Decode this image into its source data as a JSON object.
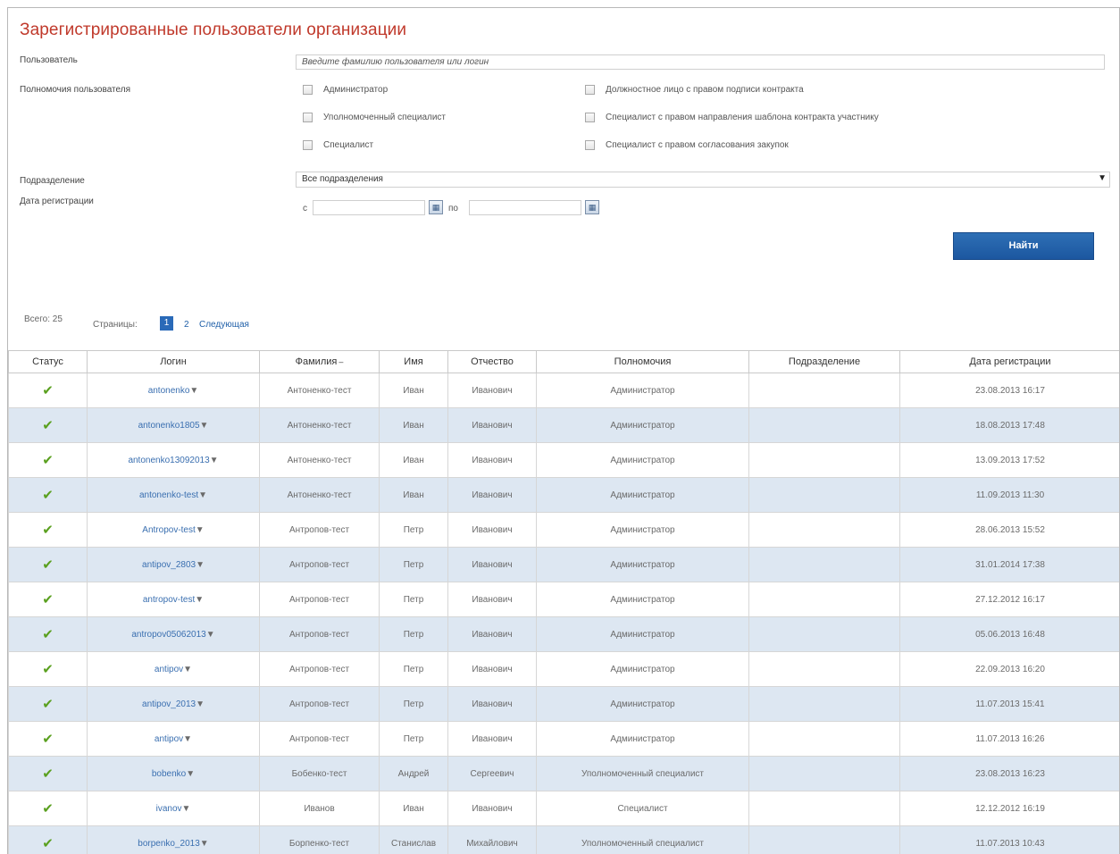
{
  "page": {
    "title": "Зарегистрированные пользователи организации"
  },
  "filters": {
    "user_label": "Пользователь",
    "user_placeholder": "Введите фамилию пользователя или логин",
    "permissions_label": "Полномочия пользователя",
    "permissions": [
      {
        "label": "Администратор",
        "checked": false
      },
      {
        "label": "Уполномоченный специалист",
        "checked": false
      },
      {
        "label": "Специалист",
        "checked": false
      },
      {
        "label": "Должностное лицо с правом подписи контракта",
        "checked": false
      },
      {
        "label": "Специалист с правом направления шаблона контракта участнику",
        "checked": false
      },
      {
        "label": "Специалист с правом согласования закупок",
        "checked": false
      }
    ],
    "dept_label": "Подразделение",
    "dept_value": "Все подразделения",
    "date_label": "Дата регистрации",
    "date_from_label": "с",
    "date_to_label": "по",
    "date_from_value": "",
    "date_to_value": "",
    "search_button": "Найти"
  },
  "pager": {
    "total_label": "Всего: 25",
    "pages_label": "Страницы:",
    "current_page": "1",
    "page_2": "2",
    "next_label": "Следующая"
  },
  "table": {
    "columns": [
      "Статус",
      "Логин",
      "Фамилия",
      "Имя",
      "Отчество",
      "Полномочия",
      "Подразделение",
      "Дата регистрации"
    ],
    "sort_column": "Фамилия",
    "rows": [
      {
        "status": "active",
        "login": "antonenko",
        "surname": "Антоненко-тест",
        "name": "Иван",
        "patronymic": "Иванович",
        "role": "Администратор",
        "dept": "",
        "date": "23.08.2013 16:17"
      },
      {
        "status": "active",
        "login": "antonenko1805",
        "surname": "Антоненко-тест",
        "name": "Иван",
        "patronymic": "Иванович",
        "role": "Администратор",
        "dept": "",
        "date": "18.08.2013 17:48"
      },
      {
        "status": "active",
        "login": "antonenko13092013",
        "surname": "Антоненко-тест",
        "name": "Иван",
        "patronymic": "Иванович",
        "role": "Администратор",
        "dept": "",
        "date": "13.09.2013 17:52"
      },
      {
        "status": "active",
        "login": "antonenko-test",
        "surname": "Антоненко-тест",
        "name": "Иван",
        "patronymic": "Иванович",
        "role": "Администратор",
        "dept": "",
        "date": "11.09.2013 11:30"
      },
      {
        "status": "active",
        "login": "Antropov-test",
        "surname": "Антропов-тест",
        "name": "Петр",
        "patronymic": "Иванович",
        "role": "Администратор",
        "dept": "",
        "date": "28.06.2013 15:52"
      },
      {
        "status": "active",
        "login": "antipov_2803",
        "surname": "Антропов-тест",
        "name": "Петр",
        "patronymic": "Иванович",
        "role": "Администратор",
        "dept": "",
        "date": "31.01.2014 17:38"
      },
      {
        "status": "active",
        "login": "antropov-test",
        "surname": "Антропов-тест",
        "name": "Петр",
        "patronymic": "Иванович",
        "role": "Администратор",
        "dept": "",
        "date": "27.12.2012 16:17"
      },
      {
        "status": "active",
        "login": "antropov05062013",
        "surname": "Антропов-тест",
        "name": "Петр",
        "patronymic": "Иванович",
        "role": "Администратор",
        "dept": "",
        "date": "05.06.2013 16:48"
      },
      {
        "status": "active",
        "login": "antipov",
        "surname": "Антропов-тест",
        "name": "Петр",
        "patronymic": "Иванович",
        "role": "Администратор",
        "dept": "",
        "date": "22.09.2013 16:20"
      },
      {
        "status": "active",
        "login": "antipov_2013",
        "surname": "Антропов-тест",
        "name": "Петр",
        "patronymic": "Иванович",
        "role": "Администратор",
        "dept": "",
        "date": "11.07.2013 15:41"
      },
      {
        "status": "active",
        "login": "antipov",
        "surname": "Антропов-тест",
        "name": "Петр",
        "patronymic": "Иванович",
        "role": "Администратор",
        "dept": "",
        "date": "11.07.2013 16:26"
      },
      {
        "status": "active",
        "login": "bobenko",
        "surname": "Бобенко-тест",
        "name": "Андрей",
        "patronymic": "Сергеевич",
        "role": "Уполномоченный специалист",
        "dept": "",
        "date": "23.08.2013 16:23"
      },
      {
        "status": "active",
        "login": "ivanov",
        "surname": "Иванов",
        "name": "Иван",
        "patronymic": "Иванович",
        "role": "Специалист",
        "dept": "",
        "date": "12.12.2012 16:19"
      },
      {
        "status": "active",
        "login": "borpenko_2013",
        "surname": "Борпенко-тест",
        "name": "Станислав",
        "patronymic": "Михайлович",
        "role": "Уполномоченный специалист",
        "dept": "",
        "date": "11.07.2013 10:43"
      }
    ]
  },
  "colors": {
    "title": "#c0392b",
    "accent": "#1c57a0",
    "row_alt": "#dde7f2",
    "check": "#5aa01f"
  }
}
